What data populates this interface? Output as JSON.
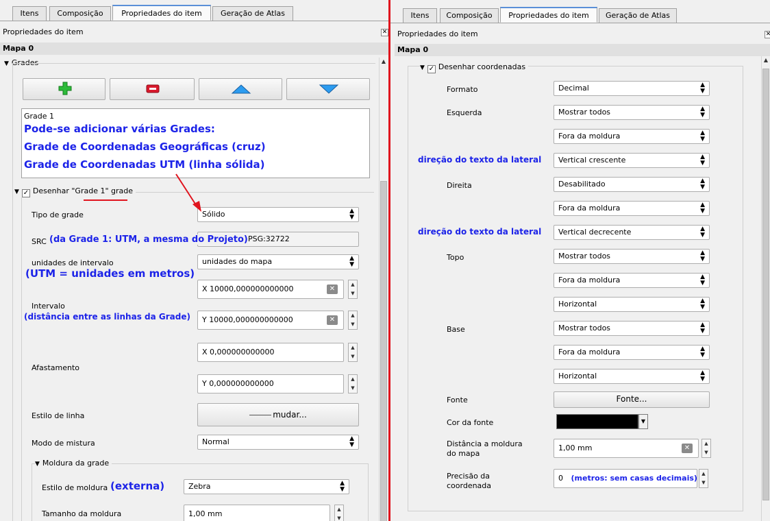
{
  "tabs": [
    "Itens",
    "Composição",
    "Propriedades do item",
    "Geração de Atlas"
  ],
  "panel_title": "Propriedades do item",
  "map_title": "Mapa 0",
  "left": {
    "grades_label": "Grades",
    "grid_list_item": "Grade 1",
    "annotation_grids": [
      "Pode-se adicionar várias Grades:",
      "Grade de Coordenadas Geográficas (cruz)",
      "Grade de Coordenadas UTM (linha sólida)"
    ],
    "draw_grid_prefix": "Desenhar ",
    "draw_grid_name": "\"Grade 1\"",
    "draw_grid_suffix": " grade",
    "grid_type_label": "Tipo de grade",
    "grid_type_value": "Sólido",
    "src_label": "SRC",
    "src_annotation": "(da Grade 1: UTM, a mesma do Projeto)",
    "src_value": "EPSG:32722",
    "interval_units_label": "unidades de intervalo",
    "interval_units_value": "unidades do mapa",
    "interval_units_annotation": "(UTM = unidades em metros)",
    "interval_label": "Intervalo",
    "interval_annotation": "(distância entre as linhas da Grade)",
    "interval_x": "X 10000,000000000000",
    "interval_y": "Y 10000,000000000000",
    "offset_label": "Afastamento",
    "offset_x": "X 0,000000000000",
    "offset_y": "Y 0,000000000000",
    "line_style_label": "Estilo de linha",
    "line_style_button": "mudar...",
    "blend_label": "Modo de mistura",
    "blend_value": "Normal",
    "frame_group_label": "Moldura da grade",
    "frame_style_label": "Estilo de moldura",
    "frame_style_annotation": "(externa)",
    "frame_style_value": "Zebra",
    "frame_size_label": "Tamanho da moldura",
    "frame_size_value": "1,00 mm"
  },
  "right": {
    "draw_coords_label": "Desenhar coordenadas",
    "format_label": "Formato",
    "format_value": "Decimal",
    "left_label": "Esquerda",
    "left_show": "Mostrar todos",
    "left_pos": "Fora da moldura",
    "left_dir_annotation": "direção do texto da lateral",
    "left_dir": "Vertical crescente",
    "right_label": "Direita",
    "right_show": "Desabilitado",
    "right_pos": "Fora da moldura",
    "right_dir_annotation": "direção do texto da lateral",
    "right_dir": "Vertical decrecente",
    "top_label": "Topo",
    "top_show": "Mostrar todos",
    "top_pos": "Fora da moldura",
    "top_dir": "Horizontal",
    "bottom_label": "Base",
    "bottom_show": "Mostrar todos",
    "bottom_pos": "Fora da moldura",
    "bottom_dir": "Horizontal",
    "font_label": "Fonte",
    "font_button": "Fonte...",
    "font_color_label": "Cor da fonte",
    "font_color": "#000000",
    "distance_label": [
      "Distância a moldura",
      "do mapa"
    ],
    "distance_value": "1,00 mm",
    "precision_label": [
      "Precisão da",
      "coordenada"
    ],
    "precision_value": "0",
    "precision_annotation": "(metros: sem casas decimais)"
  },
  "colors": {
    "annotation": "#1c23e8",
    "divider": "#e0141e",
    "arrow": "#e0141e",
    "tab_accent": "#5a8fd8"
  }
}
